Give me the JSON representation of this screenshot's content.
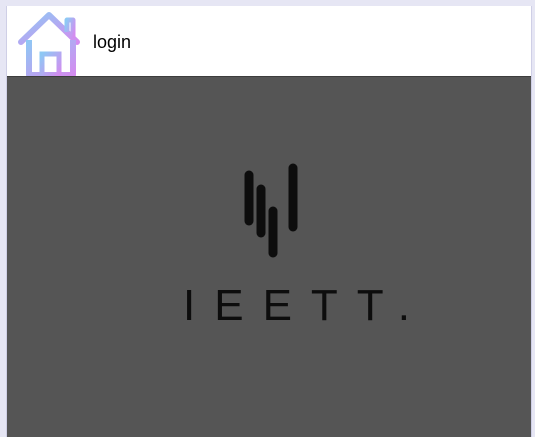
{
  "window": {
    "title": "login",
    "icon": "home-icon"
  },
  "brand": {
    "logo_icon": "ieett-logo-mark",
    "name": "IEETT."
  },
  "colors": {
    "content_background": "#555555",
    "logo": "#0d0d0d",
    "icon_gradient_start": "#8ec8f4",
    "icon_gradient_end": "#d48cf0"
  }
}
